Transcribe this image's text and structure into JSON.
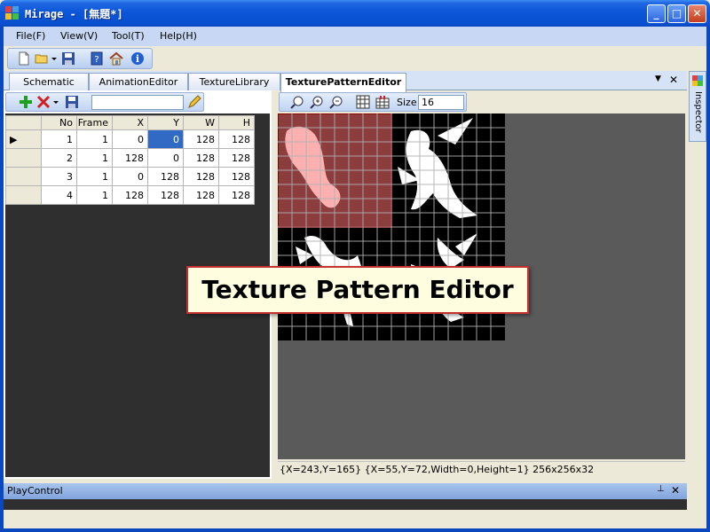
{
  "window": {
    "title": "Mirage - [無題*]",
    "minimize": "_",
    "maximize": "□",
    "close": "✕"
  },
  "menu": {
    "items": [
      "File(F)",
      "View(V)",
      "Tool(T)",
      "Help(H)"
    ]
  },
  "main_toolbar": {
    "icons": [
      "new-file-icon",
      "open-folder-icon",
      "dropdown-arrow-icon",
      "save-icon",
      "help-book-icon",
      "home-icon",
      "info-icon"
    ]
  },
  "tabs": {
    "items": [
      "Schematic",
      "AnimationEditor",
      "TextureLibrary",
      "TexturePatternEditor"
    ],
    "active": "TexturePatternEditor",
    "pin": "▼",
    "close": "✕"
  },
  "grid_toolbar": {
    "icons": [
      "add-icon",
      "delete-icon",
      "save-icon",
      "pencil-icon"
    ],
    "input_value": ""
  },
  "grid": {
    "columns": [
      "No",
      "Frame",
      "X",
      "Y",
      "W",
      "H"
    ],
    "rows": [
      {
        "no": "1",
        "frame": "1",
        "x": "0",
        "y": "0",
        "w": "128",
        "h": "128",
        "current": true
      },
      {
        "no": "2",
        "frame": "1",
        "x": "128",
        "y": "0",
        "w": "128",
        "h": "128",
        "current": false
      },
      {
        "no": "3",
        "frame": "1",
        "x": "0",
        "y": "128",
        "w": "128",
        "h": "128",
        "current": false
      },
      {
        "no": "4",
        "frame": "1",
        "x": "128",
        "y": "128",
        "w": "128",
        "h": "128",
        "current": false
      }
    ],
    "selected_cell": "row1.y"
  },
  "editor_toolbar": {
    "icons": [
      "zoom-fit-icon",
      "zoom-in-icon",
      "zoom-out-icon",
      "grid-icon",
      "snap-icon"
    ],
    "size_label": "Size",
    "size_value": "16"
  },
  "status": {
    "text": "{X=243,Y=165} {X=55,Y=72,Width=0,Height=1} 256x256x32"
  },
  "inspector": {
    "label": "Inspector"
  },
  "callout": {
    "text": "Texture Pattern Editor"
  },
  "playcontrol": {
    "title": "PlayControl",
    "pin": "📌",
    "close": "✕"
  },
  "colors": {
    "selection": "#316ac5",
    "highlight_region": "#ff7070",
    "callout_border": "#c53030"
  }
}
